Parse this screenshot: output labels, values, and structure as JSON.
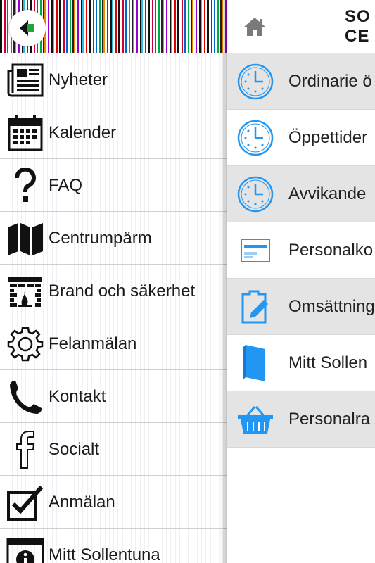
{
  "main": {
    "brand": [
      "SO",
      "CE"
    ],
    "items": [
      {
        "label": "Ordinarie ö",
        "icon": "clock-icon"
      },
      {
        "label": "Öppettider",
        "icon": "clock-icon"
      },
      {
        "label": "Avvikande",
        "icon": "clock-icon"
      },
      {
        "label": "Personalko",
        "icon": "card-icon"
      },
      {
        "label": "Omsättning",
        "icon": "clipboard-edit-icon"
      },
      {
        "label": "Mitt Sollen",
        "icon": "book-icon"
      },
      {
        "label": "Personalra",
        "icon": "basket-icon"
      }
    ],
    "accent": "#2196f3"
  },
  "drawer": {
    "items": [
      {
        "label": "Nyheter",
        "icon": "newspaper-icon"
      },
      {
        "label": "Kalender",
        "icon": "calendar-icon"
      },
      {
        "label": "FAQ",
        "icon": "question-icon"
      },
      {
        "label": "Centrumpärm",
        "icon": "map-icon"
      },
      {
        "label": "Brand och säkerhet",
        "icon": "fireplace-icon"
      },
      {
        "label": "Felanmälan",
        "icon": "gear-icon"
      },
      {
        "label": "Kontakt",
        "icon": "phone-icon"
      },
      {
        "label": "Socialt",
        "icon": "facebook-icon"
      },
      {
        "label": "Anmälan",
        "icon": "checkbox-icon"
      },
      {
        "label": "Mitt Sollentuna",
        "icon": "info-window-icon"
      }
    ]
  }
}
